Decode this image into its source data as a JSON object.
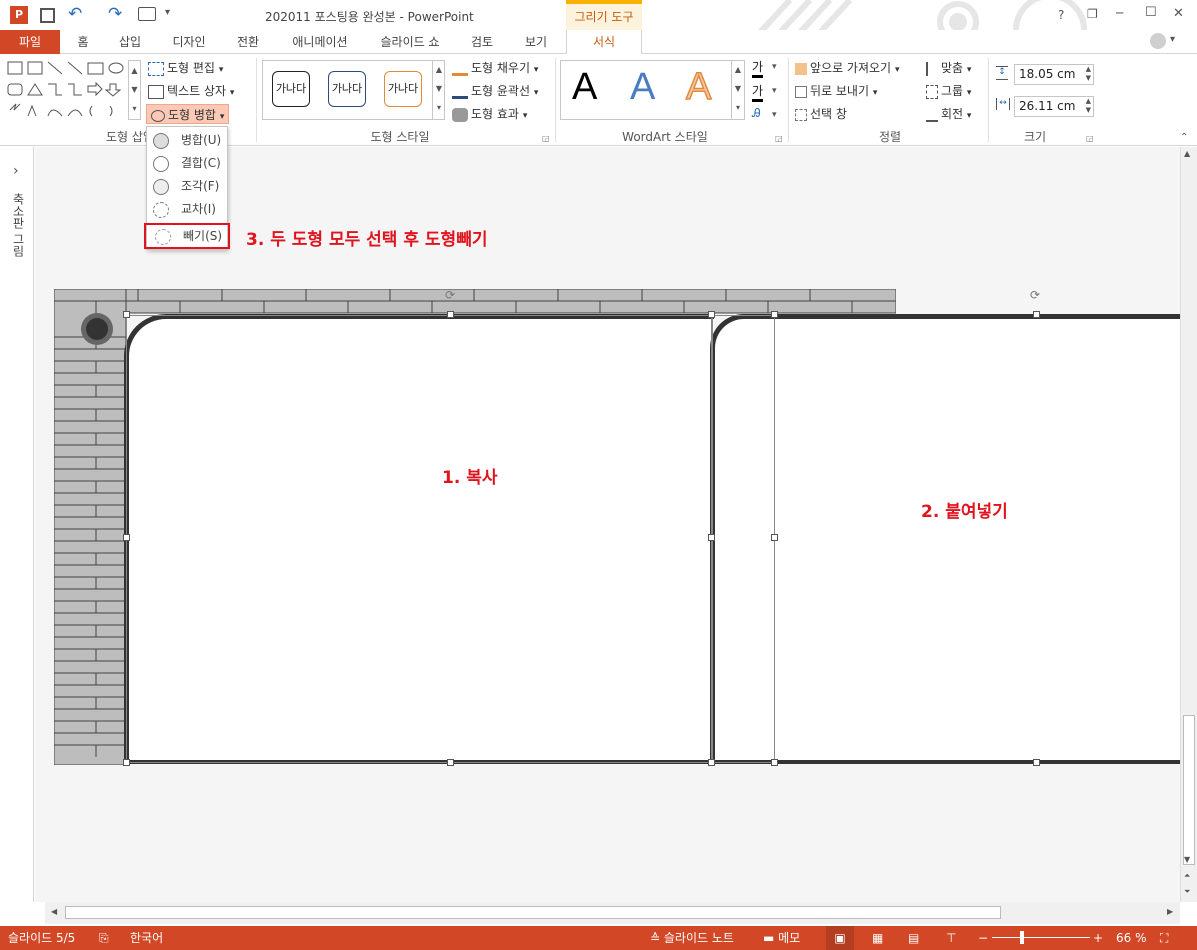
{
  "window": {
    "title": "202011 포스팅용 완성본 - PowerPoint",
    "context_tab_group": "그리기 도구",
    "help_label": "?",
    "minimize_label": "─",
    "restore_label": "❐",
    "maximize_label": "☐",
    "close_label": "✕"
  },
  "tabs": {
    "file": "파일",
    "home": "홈",
    "insert": "삽입",
    "design": "디자인",
    "transitions": "전환",
    "animations": "애니메이션",
    "slideshow": "슬라이드 쇼",
    "review": "검토",
    "view": "보기",
    "format": "서식"
  },
  "ribbon": {
    "insert_shapes": {
      "label": "도형 삽입",
      "edit_shape": "도형 편집",
      "text_box": "텍스트 상자",
      "merge_shapes": "도형 병합"
    },
    "shape_styles": {
      "label": "도형 스타일",
      "samples": [
        "가나다",
        "가나다",
        "가나다"
      ],
      "fill": "도형 채우기",
      "outline": "도형 윤곽선",
      "effects": "도형 효과"
    },
    "wordart": {
      "label": "WordArt 스타일",
      "samples": [
        "A",
        "A",
        "A"
      ],
      "text_fill_glyph": "가",
      "text_outline_glyph": "가"
    },
    "arrange": {
      "label": "정렬",
      "bring_forward": "앞으로 가져오기",
      "send_backward": "뒤로 보내기",
      "selection_pane": "선택 창",
      "align": "맞춤",
      "group": "그룹",
      "rotate": "회전"
    },
    "size": {
      "label": "크기",
      "height": "18.05 cm",
      "width": "26.11 cm"
    }
  },
  "merge_menu": {
    "items": [
      "병합(U)",
      "결합(C)",
      "조각(F)",
      "교차(I)",
      "빼기(S)"
    ]
  },
  "left_pane": {
    "label": "축소판 그림",
    "expand": "›"
  },
  "annotations": {
    "step1": "1. 복사",
    "step2": "2. 붙여넣기",
    "step3": "3. 두 도형 모두 선택 후 도형빼기"
  },
  "status": {
    "slide": "슬라이드 5/5",
    "language": "한국어",
    "notes": "슬라이드 노트",
    "comments": "메모",
    "zoom": "66 %",
    "zoom_level": 0.66
  },
  "colors": {
    "accent": "#d24726",
    "context_tab": "#f8b100",
    "annotation": "#e0141e",
    "brick": "#bdbdbd"
  }
}
